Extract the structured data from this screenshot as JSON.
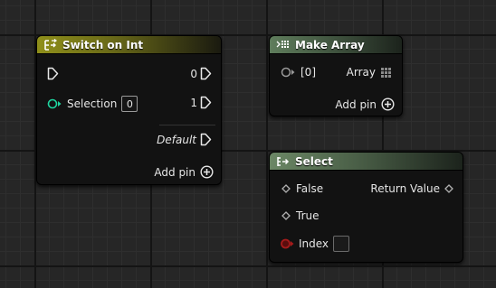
{
  "switch_node": {
    "title": "Switch on Int",
    "selection_label": "Selection",
    "selection_value": "0",
    "out_0": "0",
    "out_1": "1",
    "default_label": "Default",
    "add_pin": "Add pin"
  },
  "make_array_node": {
    "title": "Make Array",
    "in_label": "[0]",
    "out_label": "Array",
    "add_pin": "Add pin"
  },
  "select_node": {
    "title": "Select",
    "false_label": "False",
    "true_label": "True",
    "index_label": "Index",
    "return_label": "Return Value"
  },
  "colors": {
    "int_pin": "#1fd6a0",
    "index_pin": "#a61b1b",
    "wildcard_pin": "#9a9a9a"
  }
}
